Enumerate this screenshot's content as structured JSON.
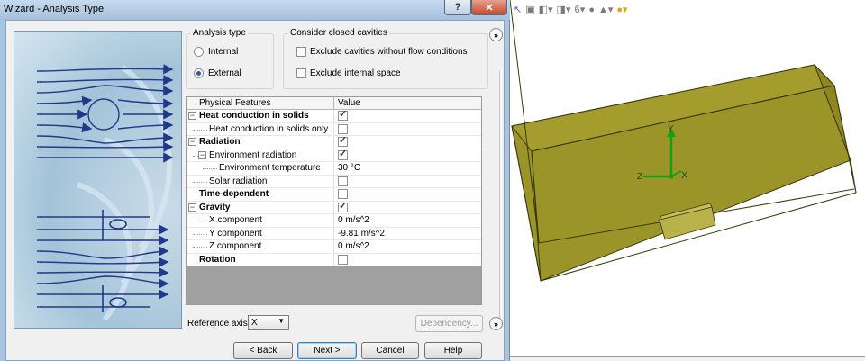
{
  "window": {
    "title": "Wizard - Analysis Type",
    "help_glyph": "?",
    "close_glyph": "✕"
  },
  "analysis_type": {
    "title": "Analysis type",
    "options": [
      {
        "label": "Internal",
        "selected": false
      },
      {
        "label": "External",
        "selected": true
      }
    ]
  },
  "closed_cavities": {
    "title": "Consider closed cavities",
    "options": [
      {
        "label": "Exclude cavities without flow conditions",
        "checked": false
      },
      {
        "label": "Exclude internal space",
        "checked": false
      }
    ]
  },
  "grid": {
    "col_feature": "Physical Features",
    "col_value": "Value",
    "rows": [
      {
        "label": "Heat conduction in solids",
        "value_type": "check",
        "checked": true
      },
      {
        "label": "Heat conduction in solids only",
        "value_type": "check",
        "checked": false
      },
      {
        "label": "Radiation",
        "value_type": "check",
        "checked": true
      },
      {
        "label": "Environment radiation",
        "value_type": "check",
        "checked": true
      },
      {
        "label": "Environment temperature",
        "value_type": "text",
        "value": "30 °C"
      },
      {
        "label": "Solar radiation",
        "value_type": "check",
        "checked": false
      },
      {
        "label": "Time-dependent",
        "value_type": "check",
        "checked": false
      },
      {
        "label": "Gravity",
        "value_type": "check",
        "checked": true
      },
      {
        "label": "X component",
        "value_type": "text",
        "value": "0 m/s^2"
      },
      {
        "label": "Y component",
        "value_type": "text",
        "value": "-9.81 m/s^2"
      },
      {
        "label": "Z component",
        "value_type": "text",
        "value": "0 m/s^2"
      },
      {
        "label": "Rotation",
        "value_type": "check",
        "checked": false
      }
    ]
  },
  "reference_axis": {
    "label": "Reference axis:",
    "value": "X"
  },
  "buttons": {
    "dependency": "Dependency...",
    "back": "< Back",
    "next": "Next >",
    "cancel": "Cancel",
    "help": "Help",
    "collapse_glyph": "»"
  },
  "viewport": {
    "axis_x": "X",
    "axis_y": "Y",
    "axis_z": "Z",
    "box_color": "#8a8420",
    "box_face_color": "#b5ad3a"
  }
}
